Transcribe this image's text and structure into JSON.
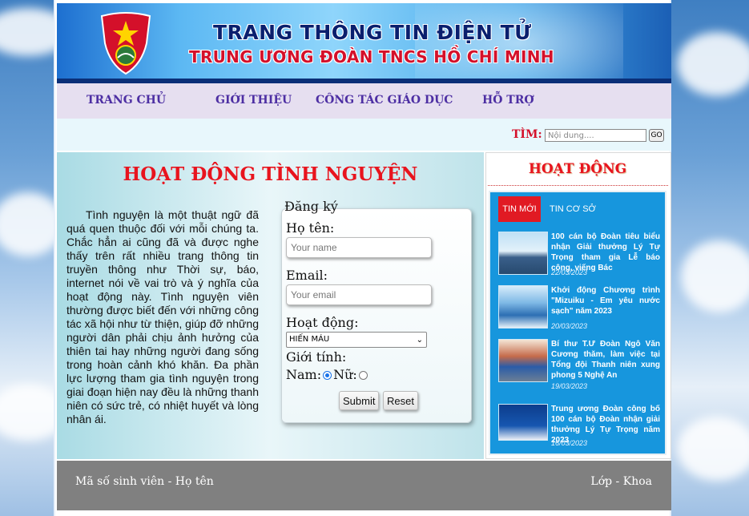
{
  "banner": {
    "title": "TRANG THÔNG TIN ĐIỆN TỬ",
    "subtitle": "TRUNG ƯƠNG ĐOÀN TNCS HỒ CHÍ MINH",
    "logo_icon": "youth-union-logo"
  },
  "nav": {
    "items": [
      {
        "label": "TRANG CHỦ"
      },
      {
        "label": "GIỚI THIỆU"
      },
      {
        "label": "CÔNG TÁC GIÁO DỤC"
      },
      {
        "label": "HỖ TRỢ"
      }
    ]
  },
  "search": {
    "label": "TÌM:",
    "placeholder": "Nội dung....",
    "button": "GO"
  },
  "main": {
    "title": "HOẠT ĐỘNG TÌNH NGUYỆN",
    "intro": "Tình nguyện là một thuật ngữ đã quá quen thuộc đối với mỗi chúng ta. Chắc hẳn ai cũng đã và được nghe thấy trên rất nhiều trang thông tin truyền thông như Thời sự, báo, internet nói về vai trò và ý nghĩa của hoạt động này. Tình nguyện viên thường được biết đến với những công tác xã hội như từ thiện, giúp đỡ những người dân phải chịu ảnh hưởng của thiên tai hay những người đang sống trong hoàn cảnh khó khăn. Đa phần lực lượng tham gia tình nguyện trong giai đoạn hiện nay đều là những thanh niên có sức trẻ, có nhiệt huyết và lòng nhân ái."
  },
  "form": {
    "legend": "Đăng ký",
    "name_label": "Họ tên:",
    "name_placeholder": "Your name",
    "email_label": "Email:",
    "email_placeholder": "Your email",
    "activity_label": "Hoạt động:",
    "activity_selected": "HIẾN MÁU",
    "gender_label": "Giới tính:",
    "male_label": "Nam:",
    "female_label": "Nữ:",
    "submit": "Submit",
    "reset": "Reset"
  },
  "sidebar": {
    "title": "HOẠT ĐỘNG",
    "tabs": [
      {
        "label": "TIN MỚI"
      },
      {
        "label": "TIN CƠ SỞ"
      }
    ],
    "news": [
      {
        "title": "100 cán bộ Đoàn tiêu biểu nhận Giải thưởng Lý Tự Trọng tham gia Lễ báo công, viếng Bác",
        "date": "22/03/2023"
      },
      {
        "title": "Khởi động Chương trình \"Mizuiku - Em yêu nước sạch\" năm 2023",
        "date": "20/03/2023"
      },
      {
        "title": "Bí thư T.Ư Đoàn Ngô Văn Cương thăm, làm việc tại Tổng đội Thanh niên xung phong 5 Nghệ An",
        "date": "19/03/2023"
      },
      {
        "title": "Trung ương Đoàn công bố 100 cán bộ Đoàn nhận giải thưởng Lý Tự Trọng năm 2023",
        "date": "16/03/2023"
      }
    ]
  },
  "footer": {
    "left": "Mã số sinh viên - Họ tên",
    "right": "Lớp - Khoa"
  }
}
